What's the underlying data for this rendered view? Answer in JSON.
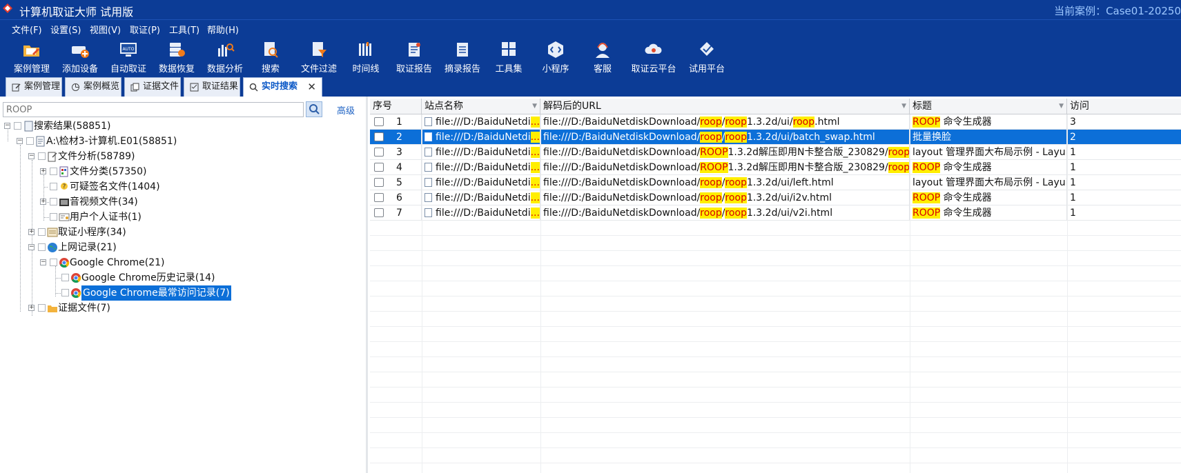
{
  "titlebar": {
    "title": "计算机取证大师 试用版",
    "case_label": "当前案例：Case01-20250"
  },
  "menu": [
    "文件(F)",
    "设置(S)",
    "视图(V)",
    "取证(P)",
    "工具(T)",
    "帮助(H)"
  ],
  "toolbar": [
    {
      "label": "案例管理",
      "icon": "folder-edit-icon"
    },
    {
      "label": "添加设备",
      "icon": "add-device-icon"
    },
    {
      "label": "自动取证",
      "icon": "auto-monitor-icon"
    },
    {
      "label": "数据恢复",
      "icon": "data-recovery-icon"
    },
    {
      "label": "数据分析",
      "icon": "data-analysis-icon"
    },
    {
      "label": "搜索",
      "icon": "search-doc-icon"
    },
    {
      "label": "文件过滤",
      "icon": "file-filter-icon"
    },
    {
      "label": "时间线",
      "icon": "timeline-icon"
    },
    {
      "label": "取证报告",
      "icon": "report-icon"
    },
    {
      "label": "摘录报告",
      "icon": "excerpt-report-icon"
    },
    {
      "label": "工具集",
      "icon": "toolset-icon"
    },
    {
      "label": "小程序",
      "icon": "mini-program-icon"
    },
    {
      "label": "客服",
      "icon": "customer-service-icon"
    },
    {
      "label": "取证云平台",
      "icon": "cloud-platform-icon"
    },
    {
      "label": "试用平台",
      "icon": "trial-platform-icon"
    }
  ],
  "tabs": [
    {
      "label": "案例管理",
      "icon": "edit-icon"
    },
    {
      "label": "案例概览",
      "icon": "pie-icon"
    },
    {
      "label": "证据文件",
      "icon": "copy-icon"
    },
    {
      "label": "取证结果",
      "icon": "checklist-icon"
    },
    {
      "label": "实时搜索",
      "icon": "search-icon",
      "active": true,
      "close": "✕"
    }
  ],
  "search": {
    "placeholder": "ROOP",
    "advanced": "高级"
  },
  "tree": [
    {
      "label": "搜索结果(58851)"
    },
    {
      "label": "A:\\检材3-计算机.E01(58851)"
    },
    {
      "label": "文件分析(58789)"
    },
    {
      "label": "文件分类(57350)"
    },
    {
      "label": "可疑签名文件(1404)"
    },
    {
      "label": "音视频文件(34)"
    },
    {
      "label": "用户个人证书(1)"
    },
    {
      "label": "取证小程序(34)"
    },
    {
      "label": "上网记录(21)"
    },
    {
      "label": "Google Chrome(21)"
    },
    {
      "label": "Google Chrome历史记录(14)"
    },
    {
      "label": "Google Chrome最常访问记录(7)",
      "selected": true
    },
    {
      "label": "证据文件(7)"
    }
  ],
  "grid": {
    "columns": [
      "序号",
      "站点名称",
      "解码后的URL",
      "标题",
      "访问"
    ],
    "rows": [
      {
        "no": "1",
        "site": "file:///D:/BaiduNetdi",
        "site_hl": "...",
        "url": [
          [
            "file:///D:/BaiduNetdiskDownload/",
            false
          ],
          [
            "roop",
            true
          ],
          [
            "/",
            false
          ],
          [
            "roop",
            true
          ],
          [
            "1.3.2d/ui/",
            false
          ],
          [
            "roop",
            true
          ],
          [
            ".html",
            false
          ]
        ],
        "title": [
          [
            "ROOP",
            true
          ],
          [
            " 命令生成器",
            false
          ]
        ],
        "visits": "3"
      },
      {
        "no": "2",
        "site": "file:///D:/BaiduNetdi",
        "site_hl": "...",
        "url": [
          [
            "file:///D:/BaiduNetdiskDownload/",
            false
          ],
          [
            "roop",
            true
          ],
          [
            "/",
            false
          ],
          [
            "roop",
            true
          ],
          [
            "1.3.2d/ui/batch_swap.html",
            false
          ]
        ],
        "title": [
          [
            "批量换脸",
            false
          ]
        ],
        "visits": "2",
        "selected": true
      },
      {
        "no": "3",
        "site": "file:///D:/BaiduNetdi",
        "site_hl": "...",
        "url": [
          [
            "file:///D:/BaiduNetdiskDownload/",
            false
          ],
          [
            "ROOP",
            true
          ],
          [
            "1.3.2d解压即用N卡整合版_230829/",
            false
          ],
          [
            "roop...",
            true
          ]
        ],
        "title": [
          [
            "layout 管理界面大布局示例 - Layui",
            false
          ]
        ],
        "visits": "1"
      },
      {
        "no": "4",
        "site": "file:///D:/BaiduNetdi",
        "site_hl": "...",
        "url": [
          [
            "file:///D:/BaiduNetdiskDownload/",
            false
          ],
          [
            "ROOP",
            true
          ],
          [
            "1.3.2d解压即用N卡整合版_230829/",
            false
          ],
          [
            "roop...",
            true
          ]
        ],
        "title": [
          [
            "ROOP",
            true
          ],
          [
            " 命令生成器",
            false
          ]
        ],
        "visits": "1"
      },
      {
        "no": "5",
        "site": "file:///D:/BaiduNetdi",
        "site_hl": "...",
        "url": [
          [
            "file:///D:/BaiduNetdiskDownload/",
            false
          ],
          [
            "roop",
            true
          ],
          [
            "/",
            false
          ],
          [
            "roop",
            true
          ],
          [
            "1.3.2d/ui/left.html",
            false
          ]
        ],
        "title": [
          [
            "layout 管理界面大布局示例 - Layui",
            false
          ]
        ],
        "visits": "1"
      },
      {
        "no": "6",
        "site": "file:///D:/BaiduNetdi",
        "site_hl": "...",
        "url": [
          [
            "file:///D:/BaiduNetdiskDownload/",
            false
          ],
          [
            "roop",
            true
          ],
          [
            "/",
            false
          ],
          [
            "roop",
            true
          ],
          [
            "1.3.2d/ui/i2v.html",
            false
          ]
        ],
        "title": [
          [
            "ROOP",
            true
          ],
          [
            " 命令生成器",
            false
          ]
        ],
        "visits": "1"
      },
      {
        "no": "7",
        "site": "file:///D:/BaiduNetdi",
        "site_hl": "...",
        "url": [
          [
            "file:///D:/BaiduNetdiskDownload/",
            false
          ],
          [
            "roop",
            true
          ],
          [
            "/",
            false
          ],
          [
            "roop",
            true
          ],
          [
            "1.3.2d/ui/v2i.html",
            false
          ]
        ],
        "title": [
          [
            "ROOP",
            true
          ],
          [
            " 命令生成器",
            false
          ]
        ],
        "visits": "1"
      }
    ]
  }
}
